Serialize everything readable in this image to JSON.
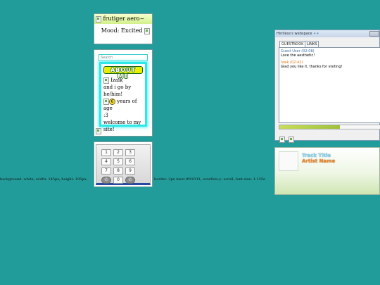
{
  "top_card": {
    "header": "frutiger aero~",
    "mood": "Mood: Excited"
  },
  "profile": {
    "search_placeholder": "Search",
    "about_title": "ABOUT ME",
    "name_line": "Izaik",
    "pronoun_line": "and i go by he/him!",
    "age_suffix": "years of age",
    "face": ":3",
    "welcome_line": "welcome to my",
    "site_line": "site!",
    "age_icon": "smiley-icon"
  },
  "keypad": {
    "keys": [
      "1",
      "2",
      "3",
      "4",
      "5",
      "6",
      "7",
      "8",
      "9",
      "0"
    ]
  },
  "css_text": {
    "left": "background: white; width: 145px; height: 195px;",
    "right": "border: 2px inset #01f1f1; overflow-y: scroll; font-size: 1.125e"
  },
  "webspace": {
    "title": "Hintless's webspace",
    "tabs": [
      "GUESTBOOK",
      "LINKS"
    ],
    "messages": [
      {
        "author": "Guest User (02:08)",
        "text": "Love the aesthetic!"
      },
      {
        "author": "Izaik (02:42)",
        "text": "Glad you like it, thanks for visiting!"
      }
    ],
    "progress": 0.6
  },
  "player": {
    "track": "Track Title",
    "artist": "Artist Name"
  },
  "colors": {
    "background": "#229c9a",
    "header_green": "#d2f08a",
    "cyan_glow": "#2ee8e8",
    "link_blue": "#3c6ea8",
    "reply_orange": "#e07818"
  }
}
